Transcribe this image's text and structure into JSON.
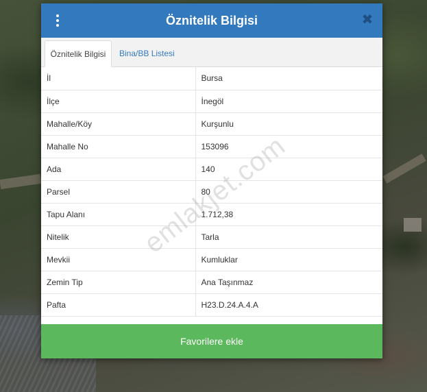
{
  "modal": {
    "title": "Öznitelik Bilgisi",
    "close_glyph": "✖",
    "favorite_button_label": "Favorilere ekle"
  },
  "tabs": [
    {
      "label": "Öznitelik Bilgisi",
      "active": true
    },
    {
      "label": "Bina/BB Listesi",
      "active": false
    }
  ],
  "attributes": [
    {
      "key": "İl",
      "value": "Bursa"
    },
    {
      "key": "İlçe",
      "value": "İnegöl"
    },
    {
      "key": "Mahalle/Köy",
      "value": "Kurşunlu"
    },
    {
      "key": "Mahalle No",
      "value": "153096"
    },
    {
      "key": "Ada",
      "value": "140"
    },
    {
      "key": "Parsel",
      "value": "80"
    },
    {
      "key": "Tapu Alanı",
      "value": "1.712,38"
    },
    {
      "key": "Nitelik",
      "value": "Tarla"
    },
    {
      "key": "Mevkii",
      "value": "Kumluklar"
    },
    {
      "key": "Zemin Tip",
      "value": "Ana Taşınmaz"
    },
    {
      "key": "Pafta",
      "value": "H23.D.24.A.4.A"
    }
  ],
  "watermark": "emlakjet.com",
  "icons": {
    "menu": "vertical-dots-icon",
    "close": "close-icon"
  },
  "colors": {
    "header": "#3379bd",
    "favorite_button": "#5cb85c",
    "tab_link": "#3379bd"
  }
}
